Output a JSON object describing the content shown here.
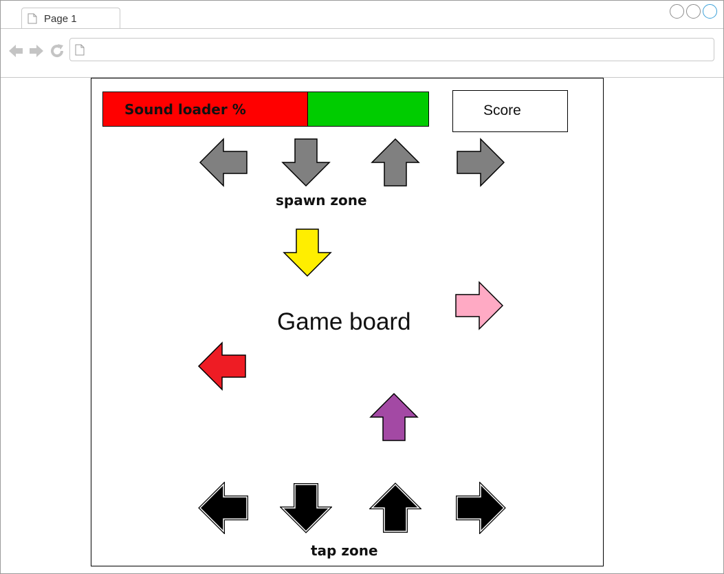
{
  "browser": {
    "tab_title": "Page 1",
    "address": "",
    "icons": {
      "tab": "document-icon",
      "back": "back-arrow-icon",
      "forward": "forward-arrow-icon",
      "reload": "reload-icon",
      "address": "document-icon"
    }
  },
  "hud": {
    "loader_label": "Sound loader %",
    "loader_progress": 0.63,
    "loader_fill_color": "#ff0000",
    "loader_remaining_color": "#00cc00",
    "score_label": "Score"
  },
  "zones": {
    "spawn_label": "spawn zone",
    "tap_label": "tap zone"
  },
  "board": {
    "title": "Game board"
  },
  "arrows": {
    "spawn": [
      {
        "dir": "left",
        "color": "#808080"
      },
      {
        "dir": "down",
        "color": "#808080"
      },
      {
        "dir": "up",
        "color": "#808080"
      },
      {
        "dir": "right",
        "color": "#808080"
      }
    ],
    "falling": [
      {
        "dir": "down",
        "color": "#ffee00"
      },
      {
        "dir": "right",
        "color": "#ffaac4"
      },
      {
        "dir": "left",
        "color": "#ee1c24"
      },
      {
        "dir": "up",
        "color": "#a349a4"
      }
    ],
    "tap": [
      {
        "dir": "left",
        "color": "#000000"
      },
      {
        "dir": "down",
        "color": "#000000"
      },
      {
        "dir": "up",
        "color": "#000000"
      },
      {
        "dir": "right",
        "color": "#000000"
      }
    ]
  }
}
